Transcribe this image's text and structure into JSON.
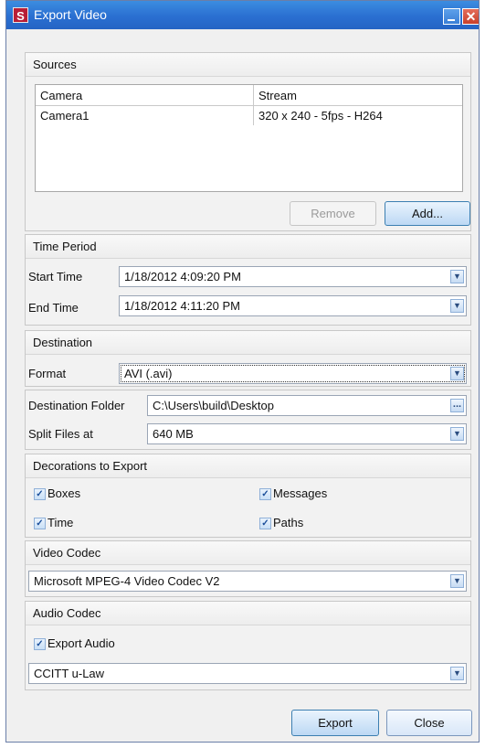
{
  "window": {
    "title": "Export Video",
    "icon_letter": "S",
    "close_glyph": "✕"
  },
  "sources": {
    "header": "Sources",
    "columns": [
      "Camera",
      "Stream"
    ],
    "rows": [
      {
        "camera": "Camera1",
        "stream": "320 x 240 - 5fps - H264"
      }
    ],
    "remove_label": "Remove",
    "add_label": "Add..."
  },
  "time_period": {
    "header": "Time Period",
    "start_label": "Start Time",
    "start_value": "1/18/2012 4:09:20 PM",
    "end_label": "End Time",
    "end_value": "1/18/2012 4:11:20 PM"
  },
  "destination": {
    "header": "Destination",
    "format_label": "Format",
    "format_value": "AVI (.avi)"
  },
  "folder": {
    "folder_label": "Destination Folder",
    "folder_value": "C:\\Users\\build\\Desktop",
    "browse_label": "...",
    "split_label": "Split Files at",
    "split_value": "640 MB"
  },
  "decorations": {
    "header": "Decorations to Export",
    "boxes": {
      "label": "Boxes",
      "checked": true
    },
    "messages": {
      "label": "Messages",
      "checked": true
    },
    "time": {
      "label": "Time",
      "checked": true
    },
    "paths": {
      "label": "Paths",
      "checked": true
    }
  },
  "video_codec": {
    "header": "Video Codec",
    "value": "Microsoft MPEG-4 Video Codec V2"
  },
  "audio_codec": {
    "header": "Audio Codec",
    "export_audio": {
      "label": "Export Audio",
      "checked": true
    },
    "value": "CCITT u-Law"
  },
  "footer": {
    "export_label": "Export",
    "close_label": "Close"
  },
  "icons": {
    "dropdown": "chevron-down-icon",
    "check": "check-icon",
    "browse": "ellipsis-icon"
  },
  "colors": {
    "titlebar": "#2a6fd1",
    "close": "#c8402b",
    "brand": "#b91e36"
  }
}
